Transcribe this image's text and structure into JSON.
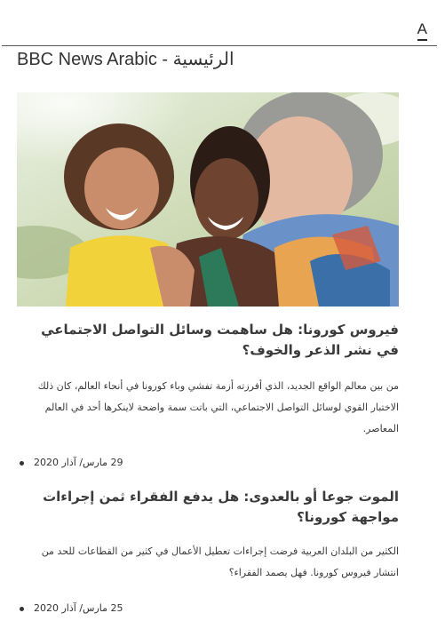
{
  "header": {
    "font_toggle_label": "A",
    "site_title": "BBC News Arabic - الرئيسية"
  },
  "articles": [
    {
      "title": "فيروس كورونا: هل ساهمت وسائل التواصل الاجتماعي في نشر الذعر والخوف؟",
      "summary": "من بين معالم الواقع الجديد، الذي أفرزته أزمة تفشي وباء كورونا في أنحاء العالم، كان ذلك الاختبار القوي لوسائل التواصل الاجتماعي، التي باتت سمة واضحة لاينكرها أحد في العالم المعاصر.",
      "date": "29 مارس/ آذار 2020",
      "image_icon": "family-photo"
    },
    {
      "title": "الموت جوعا أو بالعدوى: هل يدفع الفقراء ثمن إجراءات مواجهة كورونا؟",
      "summary": "الكثير من البلدان العربية فرضت إجراءات تعطيل الأعمال في كثير من القطاعات للحد من انتشار فيروس كورونا. فهل يصمد الفقراء؟",
      "date": "25 مارس/ آذار 2020"
    }
  ]
}
